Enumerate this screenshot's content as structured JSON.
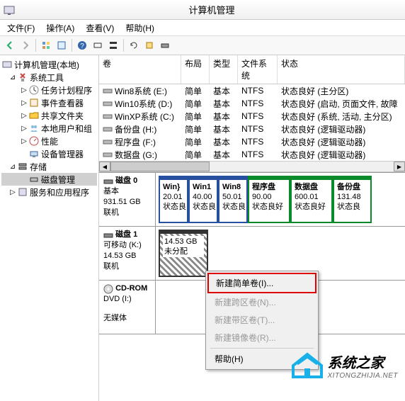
{
  "window": {
    "title": "计算机管理"
  },
  "menu": {
    "file": "文件(F)",
    "action": "操作(A)",
    "view": "查看(V)",
    "help": "帮助(H)"
  },
  "tree": {
    "root": "计算机管理(本地)",
    "sys_tools": "系统工具",
    "task_scheduler": "任务计划程序",
    "event_viewer": "事件查看器",
    "shared_folders": "共享文件夹",
    "local_users": "本地用户和组",
    "performance": "性能",
    "device_mgr": "设备管理器",
    "storage": "存储",
    "disk_mgmt": "磁盘管理",
    "services": "服务和应用程序"
  },
  "vol_headers": {
    "name": "卷",
    "layout": "布局",
    "type": "类型",
    "fs": "文件系统",
    "status": "状态"
  },
  "volumes": [
    {
      "name": "Win8系统 (E:)",
      "layout": "简单",
      "type": "基本",
      "fs": "NTFS",
      "status": "状态良好 (主分区)"
    },
    {
      "name": "Win10系统 (D:)",
      "layout": "简单",
      "type": "基本",
      "fs": "NTFS",
      "status": "状态良好 (启动, 页面文件, 故障"
    },
    {
      "name": "WinXP系统 (C:)",
      "layout": "简单",
      "type": "基本",
      "fs": "NTFS",
      "status": "状态良好 (系统, 活动, 主分区)"
    },
    {
      "name": "备份盘 (H:)",
      "layout": "简单",
      "type": "基本",
      "fs": "NTFS",
      "status": "状态良好 (逻辑驱动器)"
    },
    {
      "name": "程序盘 (F:)",
      "layout": "简单",
      "type": "基本",
      "fs": "NTFS",
      "status": "状态良好 (逻辑驱动器)"
    },
    {
      "name": "数据盘 (G:)",
      "layout": "简单",
      "type": "基本",
      "fs": "NTFS",
      "status": "状态良好 (逻辑驱动器)"
    }
  ],
  "disk0": {
    "title": "磁盘 0",
    "type": "基本",
    "size": "931.51 GB",
    "status": "联机",
    "parts": [
      {
        "name": "Win}",
        "size": "20.01",
        "st": "状态良"
      },
      {
        "name": "Win1",
        "size": "40.00",
        "st": "状态良"
      },
      {
        "name": "Win8",
        "size": "50.01",
        "st": "状态良"
      },
      {
        "name": "程序盘",
        "size": "90.00",
        "st": "状态良好"
      },
      {
        "name": "数据盘",
        "size": "600.01",
        "st": "状态良好"
      },
      {
        "name": "备份盘",
        "size": "131.48",
        "st": "状态良"
      }
    ]
  },
  "disk1": {
    "title": "磁盘 1",
    "type": "可移动 (K:)",
    "size": "14.53 GB",
    "status": "联机",
    "part": {
      "size": "14.53 GB",
      "label": "未分配"
    }
  },
  "cdrom": {
    "title": "CD-ROM",
    "drive": "DVD (I:)",
    "status": "无媒体"
  },
  "context": {
    "new_simple": "新建简单卷(I)...",
    "new_span": "新建跨区卷(N)...",
    "new_stripe": "新建带区卷(T)...",
    "new_mirror": "新建镜像卷(R)...",
    "help": "帮助(H)"
  },
  "watermark": {
    "main": "系统之家",
    "sub": "XITONGZHIJIA.NET"
  }
}
